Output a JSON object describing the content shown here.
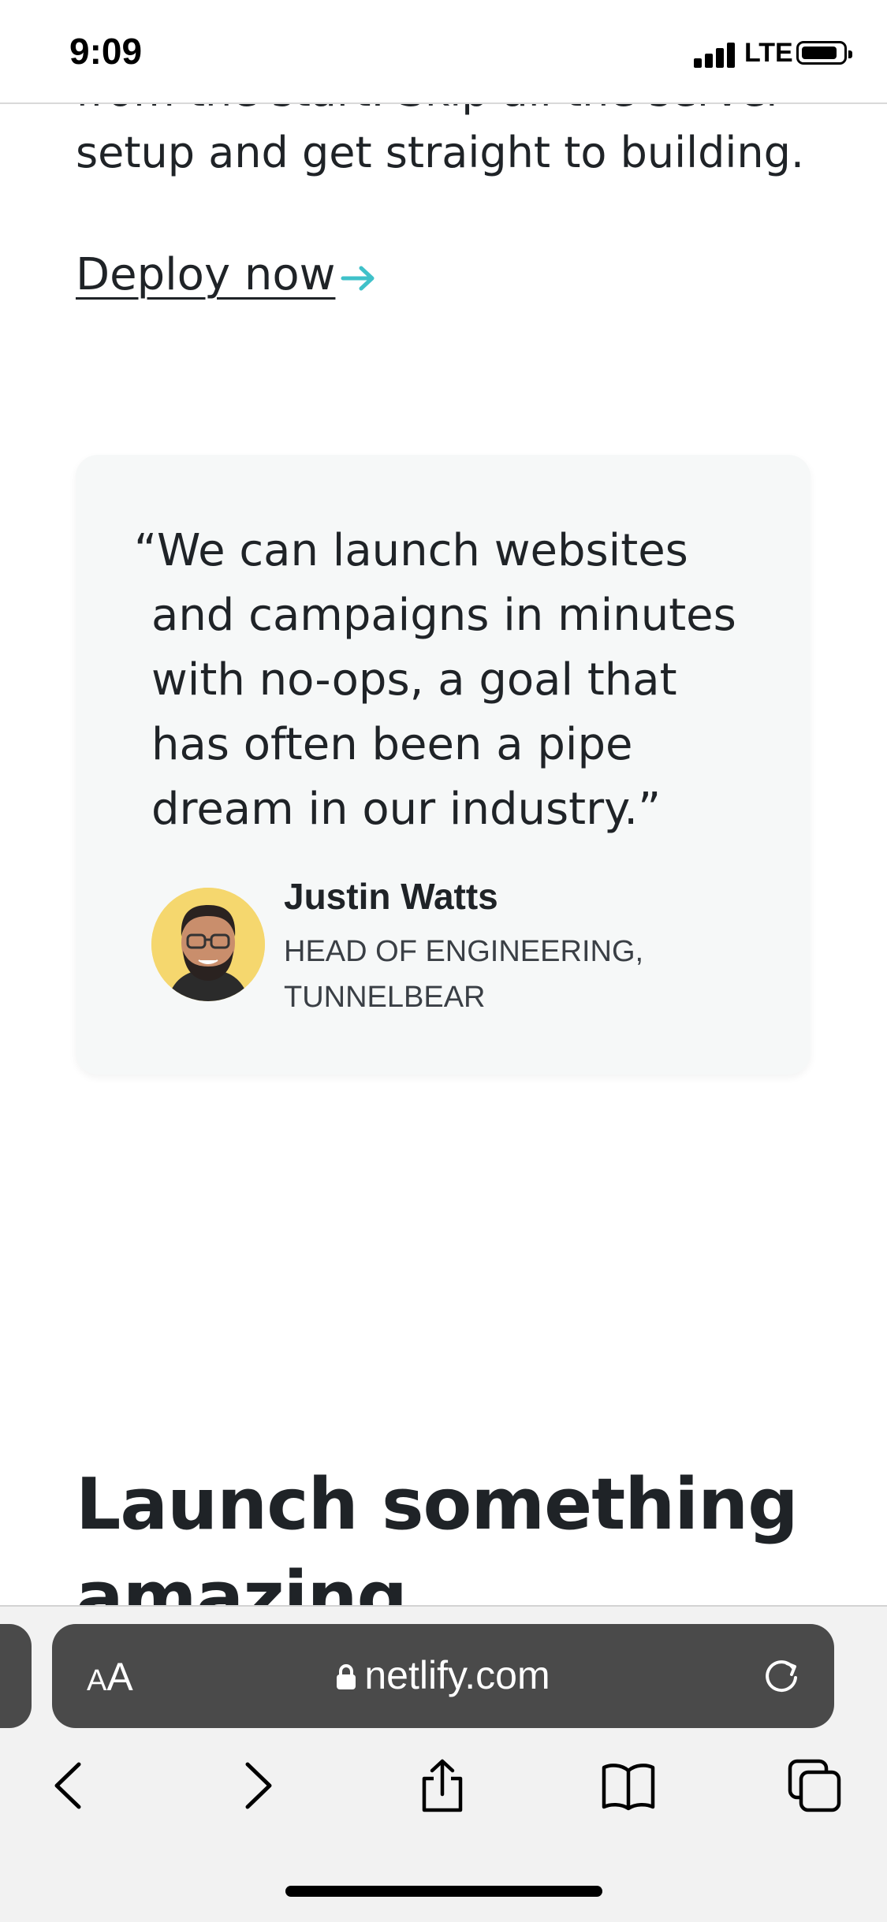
{
  "status_bar": {
    "time": "9:09",
    "network": "LTE"
  },
  "intro": {
    "partial_line": "from the start. Skip all the server",
    "line": "setup and get straight to building."
  },
  "cta": {
    "label": "Deploy now",
    "arrow_color": "#3fc1c9"
  },
  "testimonial": {
    "quote_lines": [
      "“We can launch websites",
      "and campaigns in minutes",
      "with no-ops, a goal that",
      "has often been a pipe",
      "dream in our industry.”"
    ],
    "author_name": "Justin Watts",
    "author_role_lines": [
      "HEAD OF ENGINEERING,",
      "TUNNELBEAR"
    ],
    "avatar_bg": "#f5d76e"
  },
  "section": {
    "headline": "Launch something amazing"
  },
  "browser": {
    "text_size_label_small": "A",
    "text_size_label_big": "A",
    "domain": "netlify.com",
    "icons": [
      "back-icon",
      "forward-icon",
      "share-icon",
      "bookmarks-icon",
      "tabs-icon",
      "lock-icon",
      "reload-icon"
    ]
  }
}
